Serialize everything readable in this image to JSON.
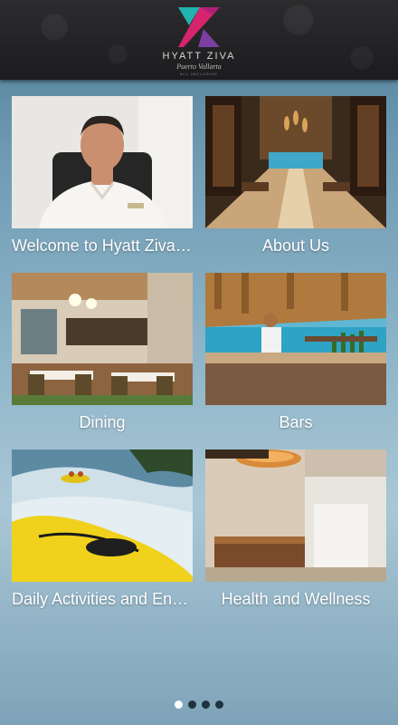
{
  "header": {
    "logo_title": "HYATT ZIVA",
    "logo_subtitle": "Puerto Vallarta",
    "logo_tagline": "ALL INCLUSIVE"
  },
  "tiles": [
    {
      "label": "Welcome to Hyatt Ziva Puerto Vallarta",
      "image": "general-manager-photo"
    },
    {
      "label": "About Us",
      "image": "lobby-photo"
    },
    {
      "label": "Dining",
      "image": "restaurant-photo"
    },
    {
      "label": "Bars",
      "image": "beach-bar-photo"
    },
    {
      "label": "Daily Activities and Entertainment",
      "image": "kayak-photo"
    },
    {
      "label": "Health and Wellness",
      "image": "spa-photo"
    }
  ],
  "pager": {
    "pages": 4,
    "current": 1
  },
  "colors": {
    "header_bg": "#1c1c1e",
    "logo_teal": "#21b3b0",
    "logo_magenta": "#d6246f",
    "label_text": "#ffffff"
  }
}
